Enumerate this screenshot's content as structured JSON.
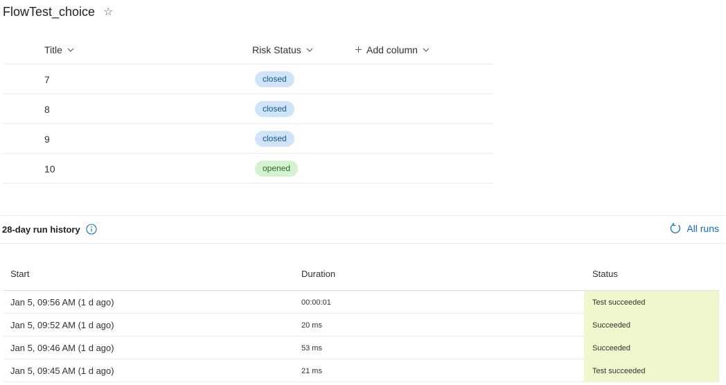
{
  "header": {
    "title": "FlowTest_choice",
    "star_icon": "star-outline-icon"
  },
  "list": {
    "columns": [
      {
        "label": "Title"
      },
      {
        "label": "Risk Status"
      },
      {
        "label": "Add column"
      }
    ],
    "rows": [
      {
        "title": "7",
        "risk": "closed"
      },
      {
        "title": "8",
        "risk": "closed"
      },
      {
        "title": "9",
        "risk": "closed"
      },
      {
        "title": "10",
        "risk": "opened"
      }
    ],
    "colors": {
      "closed_bg": "#cfe4fa",
      "closed_fg": "#0f548c",
      "opened_bg": "#d3f2d0",
      "opened_fg": "#2d6b27"
    }
  },
  "run_history": {
    "title": "28-day run history",
    "info_icon": "info-icon",
    "all_runs_label": "All runs",
    "all_runs_icon": "refresh-icon",
    "accent": "#0f6cbd",
    "columns": {
      "start": "Start",
      "duration": "Duration",
      "status": "Status"
    },
    "rows": [
      {
        "start": "Jan 5, 09:56 AM (1 d ago)",
        "duration": "00:00:01",
        "status": "Test succeeded"
      },
      {
        "start": "Jan 5, 09:52 AM (1 d ago)",
        "duration": "20 ms",
        "status": "Succeeded"
      },
      {
        "start": "Jan 5, 09:46 AM (1 d ago)",
        "duration": "53 ms",
        "status": "Succeeded"
      },
      {
        "start": "Jan 5, 09:45 AM (1 d ago)",
        "duration": "21 ms",
        "status": "Test succeeded"
      }
    ],
    "status_bg": "#eff8cd"
  }
}
